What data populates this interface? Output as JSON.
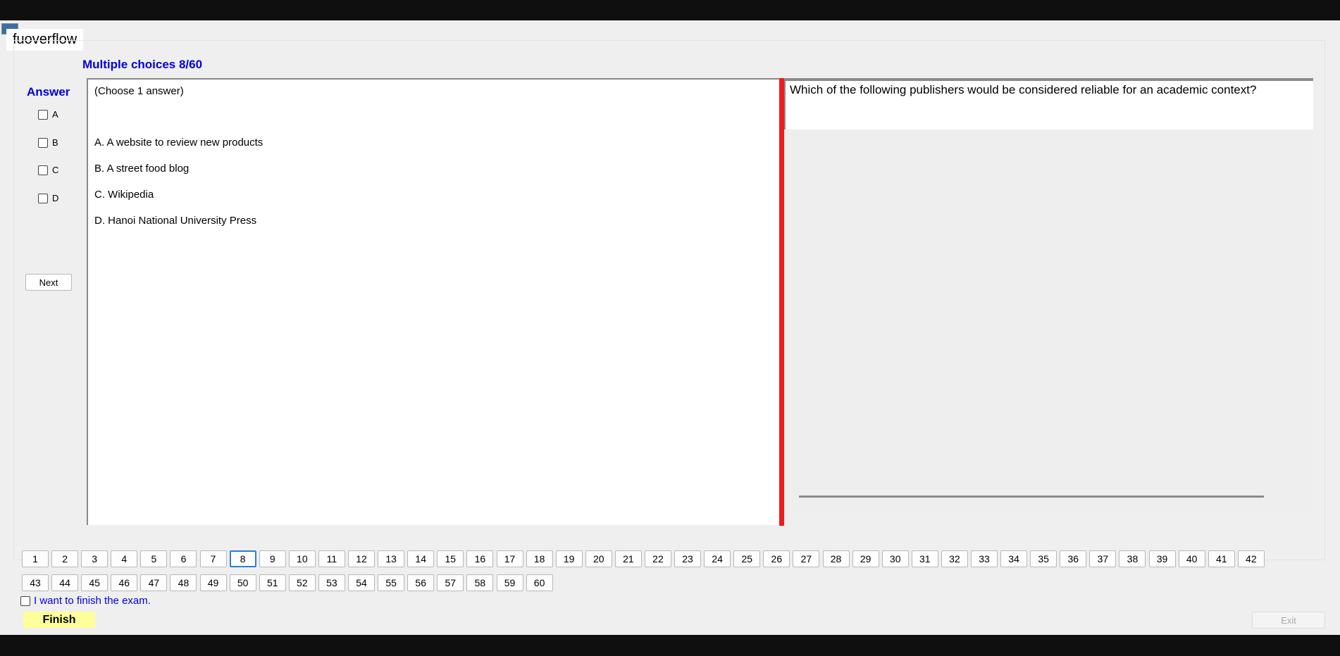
{
  "window": {
    "title": "fuoverflow"
  },
  "heading": "Multiple choices 8/60",
  "answer_panel": {
    "label": "Answer",
    "options": [
      "A",
      "B",
      "C",
      "D"
    ],
    "next_label": "Next"
  },
  "question": {
    "hint": "(Choose 1 answer)",
    "options": [
      "A.  A website to review new products",
      "B.  A street food blog",
      "C.  Wikipedia",
      "D.  Hanoi National University Press"
    ],
    "text": "Which of the following publishers would be considered reliable for an academic context?"
  },
  "pager": {
    "current": 8,
    "row1": [
      "1",
      "2",
      "3",
      "4",
      "5",
      "6",
      "7",
      "8",
      "9",
      "10",
      "11",
      "12",
      "13",
      "14",
      "15",
      "16",
      "17",
      "18",
      "19",
      "20",
      "21",
      "22",
      "23",
      "24",
      "25",
      "26",
      "27",
      "28",
      "29",
      "30",
      "31",
      "32",
      "33",
      "34",
      "35",
      "36",
      "37",
      "38",
      "39",
      "40",
      "41",
      "42"
    ],
    "row2": [
      "43",
      "44",
      "45",
      "46",
      "47",
      "48",
      "49",
      "50",
      "51",
      "52",
      "53",
      "54",
      "55",
      "56",
      "57",
      "58",
      "59",
      "60"
    ]
  },
  "footer": {
    "finish_checkbox_label": "I want to finish the exam.",
    "finish_label": "Finish",
    "exit_label": "Exit"
  },
  "colors": {
    "accent_blue": "#0000dd",
    "divider_red": "#ee1c1c",
    "finish_yellow": "#ffff99",
    "current_page_border": "#2a7fd4"
  }
}
